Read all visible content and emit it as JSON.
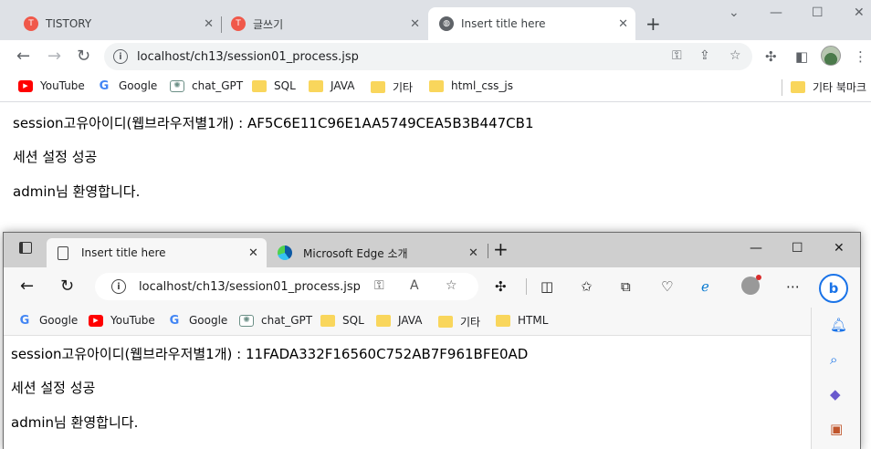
{
  "chrome": {
    "tabs": [
      {
        "label": "TISTORY",
        "favicon": "tistory-icon"
      },
      {
        "label": "글쓰기",
        "favicon": "tistory-icon"
      },
      {
        "label": "Insert title here",
        "favicon": "globe-icon"
      }
    ],
    "url": "localhost/ch13/session01_process.jsp",
    "bookmarks": [
      {
        "label": "YouTube",
        "icon": "youtube-icon"
      },
      {
        "label": "Google",
        "icon": "google-icon"
      },
      {
        "label": "chat_GPT",
        "icon": "chatgpt-icon"
      },
      {
        "label": "SQL",
        "icon": "folder-icon"
      },
      {
        "label": "JAVA",
        "icon": "folder-icon"
      },
      {
        "label": "기타",
        "icon": "folder-icon"
      },
      {
        "label": "html_css_js",
        "icon": "folder-icon"
      }
    ],
    "other_bookmarks": "기타 북마크",
    "content": {
      "line1": "session고유아이디(웹브라우저별1개) : AF5C6E11C96E1AA5749CEA5B3B447CB1",
      "line2": "세션 설정 성공",
      "line3": "admin님 환영합니다."
    }
  },
  "edge": {
    "tabs": [
      {
        "label": "Insert title here",
        "favicon": "document-icon"
      },
      {
        "label": "Microsoft Edge 소개",
        "favicon": "edge-icon"
      }
    ],
    "url": "localhost/ch13/session01_process.jsp",
    "bookmarks": [
      {
        "label": "Google",
        "icon": "google-icon"
      },
      {
        "label": "YouTube",
        "icon": "youtube-icon"
      },
      {
        "label": "Google",
        "icon": "google-icon"
      },
      {
        "label": "chat_GPT",
        "icon": "chatgpt-icon"
      },
      {
        "label": "SQL",
        "icon": "folder-icon"
      },
      {
        "label": "JAVA",
        "icon": "folder-icon"
      },
      {
        "label": "기타",
        "icon": "folder-icon"
      },
      {
        "label": "HTML",
        "icon": "folder-icon"
      }
    ],
    "content": {
      "line1": "session고유아이디(웹브라우저별1개) : 11FADA332F16560C752AB7F961BFE0AD",
      "line2": "세션 설정 성공",
      "line3": "admin님 환영합니다."
    }
  },
  "colors": {
    "chrome_tabstrip": "#dee1e6",
    "edge_titlebar": "#cfcfcf",
    "folder": "#f9d65c",
    "youtube": "#ff0000"
  }
}
